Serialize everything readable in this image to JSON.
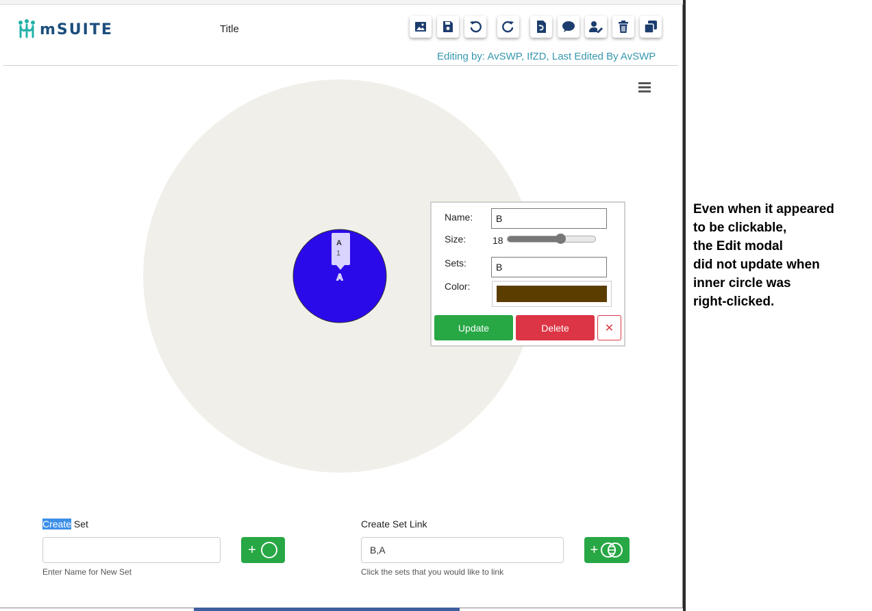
{
  "app": {
    "logo_text": "mSUITE",
    "doc_title": "Title",
    "editing_text": "Editing by: AvSWP, IfZD,  Last Edited By AvSWP"
  },
  "toolbar": {
    "buttons": [
      {
        "name": "export-image",
        "icon": "image-icon"
      },
      {
        "name": "save",
        "icon": "save-icon"
      },
      {
        "name": "undo",
        "icon": "undo-icon"
      },
      {
        "name": "redo",
        "icon": "redo-icon"
      },
      {
        "name": "reset",
        "icon": "reset-icon"
      },
      {
        "name": "chat",
        "icon": "chat-icon"
      },
      {
        "name": "edit-users",
        "icon": "user-edit-icon"
      },
      {
        "name": "delete",
        "icon": "trash-icon"
      },
      {
        "name": "copy",
        "icon": "copy-icon"
      }
    ],
    "icon_color": "#1c3d6e"
  },
  "canvas": {
    "outer_set_color": "#f1efe9",
    "inner_set": {
      "color": "#2a0ae8",
      "label": "A"
    },
    "tooltip": {
      "name": "A",
      "count": "1"
    }
  },
  "modal": {
    "name_label": "Name:",
    "name_value": "B",
    "size_label": "Size:",
    "size_value": "18",
    "size_fraction": 0.6,
    "sets_label": "Sets:",
    "sets_value": "B",
    "color_label": "Color:",
    "color_value": "#5c3d00",
    "update_label": "Update",
    "delete_label": "Delete",
    "close_label": "✕"
  },
  "create_set": {
    "label_selected": "Create",
    "label_rest": " Set",
    "input_value": "",
    "help": "Enter Name for New Set",
    "button_label": "+"
  },
  "create_link": {
    "label": "Create Set Link",
    "input_value": "B,A",
    "help": "Click the sets that you would like to link",
    "button_label": "+"
  },
  "note": {
    "lines": [
      "Even when it appeared",
      "to be clickable,",
      "the Edit modal",
      "did not update when",
      "inner circle was",
      "right-clicked."
    ]
  }
}
